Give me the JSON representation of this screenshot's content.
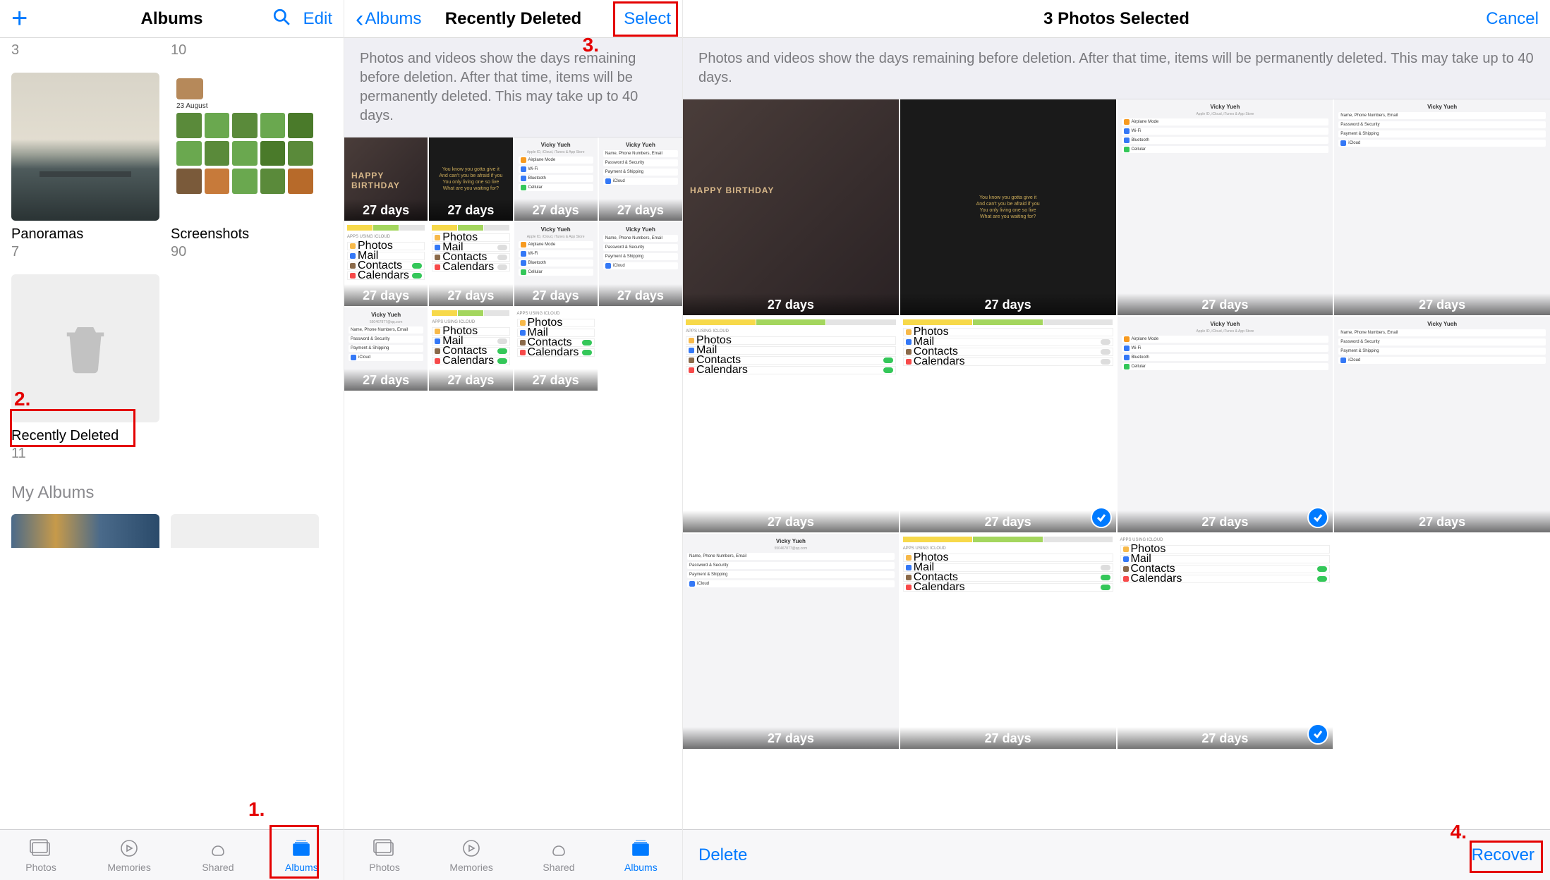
{
  "p1": {
    "nav": {
      "title": "Albums",
      "edit": "Edit"
    },
    "topRow": {
      "c1": "3",
      "c2": "10"
    },
    "panoramas": {
      "name": "Panoramas",
      "count": "7"
    },
    "screenshots": {
      "name": "Screenshots",
      "count": "90",
      "date": "23 August"
    },
    "recentlyDeleted": {
      "name": "Recently Deleted",
      "count": "11"
    },
    "sectionMyAlbums": "My Albums",
    "callout1": "1.",
    "callout2": "2."
  },
  "p2": {
    "nav": {
      "back": "Albums",
      "title": "Recently Deleted",
      "select": "Select"
    },
    "desc": "Photos and videos show the days remaining before deletion. After that time, items will be permanently deleted. This may take up to 40 days.",
    "callout3": "3.",
    "daysLabel": "27 days",
    "userName": "Vicky Yueh"
  },
  "p3": {
    "nav": {
      "title": "3 Photos Selected",
      "cancel": "Cancel"
    },
    "desc": "Photos and videos show the days remaining before deletion. After that time, items will be permanently deleted. This may take up to 40 days.",
    "daysLabel": "27 days",
    "toolbar": {
      "delete": "Delete",
      "recover": "Recover"
    },
    "callout4": "4."
  },
  "tabs": {
    "photos": "Photos",
    "memories": "Memories",
    "shared": "Shared",
    "albums": "Albums"
  }
}
